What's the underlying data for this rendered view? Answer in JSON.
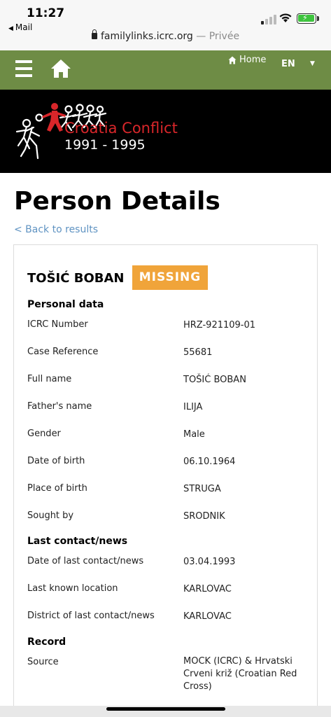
{
  "status": {
    "time": "11:27",
    "back_app": "Mail",
    "url": "familylinks.icrc.org",
    "privacy": "Privée"
  },
  "nav": {
    "home_label": "Home",
    "language": "EN"
  },
  "banner": {
    "title": "Croatia Conflict",
    "years": "1991 - 1995"
  },
  "page": {
    "title": "Person Details",
    "back_link": "< Back to results"
  },
  "person": {
    "name": "TOŠIĆ BOBAN",
    "status": "MISSING"
  },
  "sections": [
    {
      "title": "Personal data",
      "rows": [
        {
          "label": "ICRC Number",
          "value": "HRZ-921109-01"
        },
        {
          "label": "Case Reference",
          "value": "55681"
        },
        {
          "label": "Full name",
          "value": "TOŠIĆ BOBAN"
        },
        {
          "label": "Father's name",
          "value": "ILIJA"
        },
        {
          "label": "Gender",
          "value": "Male"
        },
        {
          "label": "Date of birth",
          "value": "06.10.1964"
        },
        {
          "label": "Place of birth",
          "value": "STRUGA"
        },
        {
          "label": "Sought by",
          "value": "SRODNIK"
        }
      ]
    },
    {
      "title": "Last contact/news",
      "rows": [
        {
          "label": "Date of last contact/news",
          "value": "03.04.1993"
        },
        {
          "label": "Last known location",
          "value": "KARLOVAC"
        },
        {
          "label": "District of last contact/news",
          "value": "KARLOVAC"
        }
      ]
    },
    {
      "title": "Record",
      "rows": [
        {
          "label": "Source",
          "value": "MOCK (ICRC) & Hrvatski Crveni križ (Croatian Red Cross)"
        }
      ]
    }
  ],
  "colors": {
    "nav_green": "#6e8c45",
    "banner_red": "#d8262a",
    "badge_orange": "#f0a43a",
    "link_blue": "#5f93c2"
  }
}
